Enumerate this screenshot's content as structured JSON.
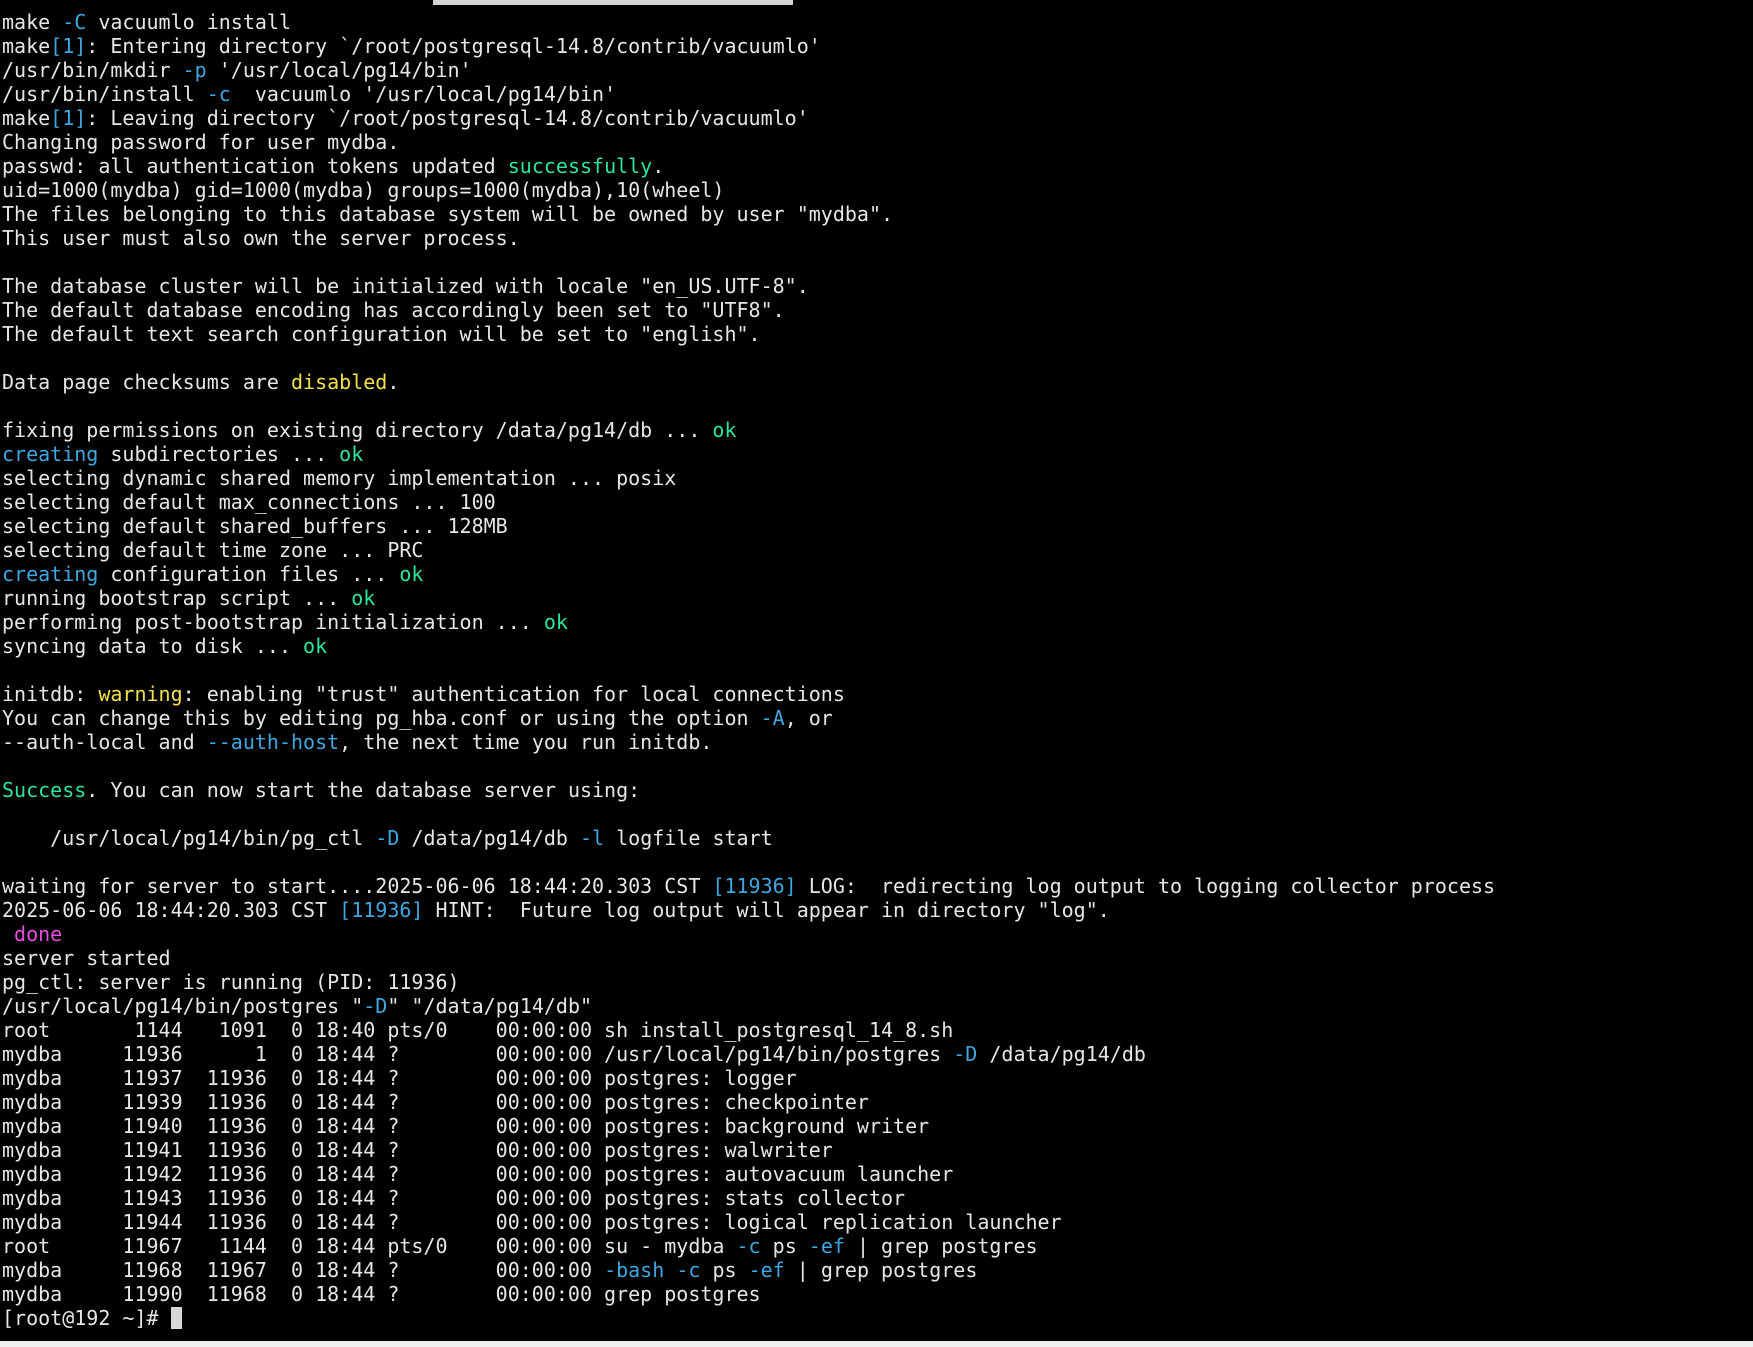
{
  "colors": {
    "background": "#000000",
    "foreground": "#e6e6e6",
    "green": "#2ee59d",
    "cyan": "#3fa7e0",
    "yellow": "#f2e14c",
    "magenta": "#e94fe0"
  },
  "terminal": {
    "prompt": "[root@192 ~]# ",
    "lines": [
      [
        [
          "make ",
          "fg"
        ],
        [
          "-C",
          "cyan"
        ],
        [
          " vacuumlo install",
          "fg"
        ]
      ],
      [
        [
          "make",
          "fg"
        ],
        [
          "[1]",
          "cyan"
        ],
        [
          ": Entering directory `/root/postgresql-14.8/contrib/vacuumlo'",
          "fg"
        ]
      ],
      [
        [
          "/usr/bin/mkdir ",
          "fg"
        ],
        [
          "-p",
          "cyan"
        ],
        [
          " '/usr/local/pg14/bin'",
          "fg"
        ]
      ],
      [
        [
          "/usr/bin/install ",
          "fg"
        ],
        [
          "-c",
          "cyan"
        ],
        [
          "  vacuumlo '/usr/local/pg14/bin'",
          "fg"
        ]
      ],
      [
        [
          "make",
          "fg"
        ],
        [
          "[1]",
          "cyan"
        ],
        [
          ": Leaving directory `/root/postgresql-14.8/contrib/vacuumlo'",
          "fg"
        ]
      ],
      [
        [
          "Changing password for user mydba.",
          "fg"
        ]
      ],
      [
        [
          "passwd: all authentication tokens updated ",
          "fg"
        ],
        [
          "successfully",
          "green"
        ],
        [
          ".",
          "fg"
        ]
      ],
      [
        [
          "uid=1000(mydba) gid=1000(mydba) groups=1000(mydba),10(wheel)",
          "fg"
        ]
      ],
      [
        [
          "The files belonging to this database system will be owned by user \"mydba\".",
          "fg"
        ]
      ],
      [
        [
          "This user must also own the server process.",
          "fg"
        ]
      ],
      [],
      [
        [
          "The database cluster will be initialized with locale \"en_US.UTF-8\".",
          "fg"
        ]
      ],
      [
        [
          "The default database encoding has accordingly been set to \"UTF8\".",
          "fg"
        ]
      ],
      [
        [
          "The default text search configuration will be set to \"english\".",
          "fg"
        ]
      ],
      [],
      [
        [
          "Data page checksums are ",
          "fg"
        ],
        [
          "disabled",
          "yellow"
        ],
        [
          ".",
          "fg"
        ]
      ],
      [],
      [
        [
          "fixing permissions on existing directory /data/pg14/db ... ",
          "fg"
        ],
        [
          "ok",
          "green"
        ]
      ],
      [
        [
          "creating",
          "cyan"
        ],
        [
          " subdirectories ... ",
          "fg"
        ],
        [
          "ok",
          "green"
        ]
      ],
      [
        [
          "selecting dynamic shared memory implementation ... posix",
          "fg"
        ]
      ],
      [
        [
          "selecting default max_connections ... 100",
          "fg"
        ]
      ],
      [
        [
          "selecting default shared_buffers ... 128MB",
          "fg"
        ]
      ],
      [
        [
          "selecting default time zone ... PRC",
          "fg"
        ]
      ],
      [
        [
          "creating",
          "cyan"
        ],
        [
          " configuration files ... ",
          "fg"
        ],
        [
          "ok",
          "green"
        ]
      ],
      [
        [
          "running bootstrap script ... ",
          "fg"
        ],
        [
          "ok",
          "green"
        ]
      ],
      [
        [
          "performing post-bootstrap initialization ... ",
          "fg"
        ],
        [
          "ok",
          "green"
        ]
      ],
      [
        [
          "syncing data to disk ... ",
          "fg"
        ],
        [
          "ok",
          "green"
        ]
      ],
      [],
      [
        [
          "initdb: ",
          "fg"
        ],
        [
          "warning",
          "yellow"
        ],
        [
          ": enabling \"trust\" authentication for local connections",
          "fg"
        ]
      ],
      [
        [
          "You can change this by editing pg_hba.conf or using the option ",
          "fg"
        ],
        [
          "-A",
          "cyan"
        ],
        [
          ", or",
          "fg"
        ]
      ],
      [
        [
          "--auth-local and ",
          "fg"
        ],
        [
          "--auth-host",
          "cyan"
        ],
        [
          ", the next time you run initdb.",
          "fg"
        ]
      ],
      [],
      [
        [
          "Success",
          "green"
        ],
        [
          ". You can now start the database server using:",
          "fg"
        ]
      ],
      [],
      [
        [
          "    /usr/local/pg14/bin/pg_ctl ",
          "fg"
        ],
        [
          "-D",
          "cyan"
        ],
        [
          " /data/pg14/db ",
          "fg"
        ],
        [
          "-l",
          "cyan"
        ],
        [
          " logfile start",
          "fg"
        ]
      ],
      [],
      [
        [
          "waiting for server to start....2025-06-06 18:44:20.303 CST ",
          "fg"
        ],
        [
          "[11936]",
          "cyan"
        ],
        [
          " LOG:  redirecting log output to logging collector process",
          "fg"
        ]
      ],
      [
        [
          "2025-06-06 18:44:20.303 CST ",
          "fg"
        ],
        [
          "[11936]",
          "cyan"
        ],
        [
          " HINT:  Future log output will appear in directory \"log\".",
          "fg"
        ]
      ],
      [
        [
          " done",
          "magenta"
        ]
      ],
      [
        [
          "server started",
          "fg"
        ]
      ],
      [
        [
          "pg_ctl: server is running (PID: 11936)",
          "fg"
        ]
      ],
      [
        [
          "/usr/local/pg14/bin/postgres \"",
          "fg"
        ],
        [
          "-D",
          "cyan"
        ],
        [
          "\" \"/data/pg14/db\"",
          "fg"
        ]
      ],
      [
        [
          "root       1144   1091  0 18:40 pts/0    00:00:00 sh install_postgresql_14_8.sh",
          "fg"
        ]
      ],
      [
        [
          "mydba     11936      1  0 18:44 ?        00:00:00 /usr/local/pg14/bin/postgres ",
          "fg"
        ],
        [
          "-D",
          "cyan"
        ],
        [
          " /data/pg14/db",
          "fg"
        ]
      ],
      [
        [
          "mydba     11937  11936  0 18:44 ?        00:00:00 postgres: logger",
          "fg"
        ]
      ],
      [
        [
          "mydba     11939  11936  0 18:44 ?        00:00:00 postgres: checkpointer",
          "fg"
        ]
      ],
      [
        [
          "mydba     11940  11936  0 18:44 ?        00:00:00 postgres: background writer",
          "fg"
        ]
      ],
      [
        [
          "mydba     11941  11936  0 18:44 ?        00:00:00 postgres: walwriter",
          "fg"
        ]
      ],
      [
        [
          "mydba     11942  11936  0 18:44 ?        00:00:00 postgres: autovacuum launcher",
          "fg"
        ]
      ],
      [
        [
          "mydba     11943  11936  0 18:44 ?        00:00:00 postgres: stats collector",
          "fg"
        ]
      ],
      [
        [
          "mydba     11944  11936  0 18:44 ?        00:00:00 postgres: logical replication launcher",
          "fg"
        ]
      ],
      [
        [
          "root      11967   1144  0 18:44 pts/0    00:00:00 su - mydba ",
          "fg"
        ],
        [
          "-c",
          "cyan"
        ],
        [
          " ps ",
          "fg"
        ],
        [
          "-ef",
          "cyan"
        ],
        [
          " | grep postgres",
          "fg"
        ]
      ],
      [
        [
          "mydba     11968  11967  0 18:44 ?        00:00:00 ",
          "fg"
        ],
        [
          "-bash",
          "cyan"
        ],
        [
          " ",
          "fg"
        ],
        [
          "-c",
          "cyan"
        ],
        [
          " ps ",
          "fg"
        ],
        [
          "-ef",
          "cyan"
        ],
        [
          " | grep postgres",
          "fg"
        ]
      ],
      [
        [
          "mydba     11990  11968  0 18:44 ?        00:00:00 grep postgres",
          "fg"
        ]
      ]
    ]
  }
}
